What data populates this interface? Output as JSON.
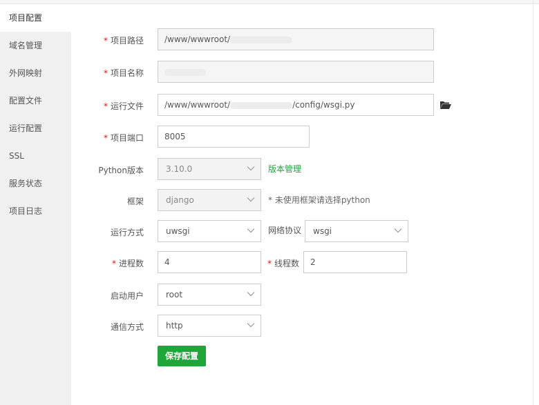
{
  "sidebar": {
    "items": [
      {
        "label": "项目配置"
      },
      {
        "label": "域名管理"
      },
      {
        "label": "外网映射"
      },
      {
        "label": "配置文件"
      },
      {
        "label": "运行配置"
      },
      {
        "label": "SSL"
      },
      {
        "label": "服务状态"
      },
      {
        "label": "项目日志"
      }
    ]
  },
  "form": {
    "required_mark": "*",
    "project_path": {
      "label": "项目路径",
      "value_prefix": "/www/wwwroot/"
    },
    "project_name": {
      "label": "项目名称"
    },
    "run_file": {
      "label": "运行文件",
      "value_prefix": "/www/wwwroot/",
      "value_suffix": "/config/wsgi.py",
      "folder_icon": "folder-open-icon"
    },
    "project_port": {
      "label": "项目端口",
      "value": "8005"
    },
    "python_version": {
      "label": "Python版本",
      "value": "3.10.0",
      "version_manage_link": "版本管理"
    },
    "framework": {
      "label": "框架",
      "value": "django",
      "hint": "* 未使用框架请选择python"
    },
    "run_mode": {
      "label": "运行方式",
      "value": "uwsgi"
    },
    "network_protocol": {
      "label": "网络协议",
      "value": "wsgi"
    },
    "processes": {
      "label": "进程数",
      "value": "4"
    },
    "threads": {
      "label": "线程数",
      "value": "2"
    },
    "start_user": {
      "label": "启动用户",
      "value": "root"
    },
    "comm_mode": {
      "label": "通信方式",
      "value": "http"
    },
    "save_button": "保存配置"
  },
  "colors": {
    "accent": "#20a53a",
    "required": "#ef0808",
    "sidebar_bg": "#f0f0f0"
  }
}
